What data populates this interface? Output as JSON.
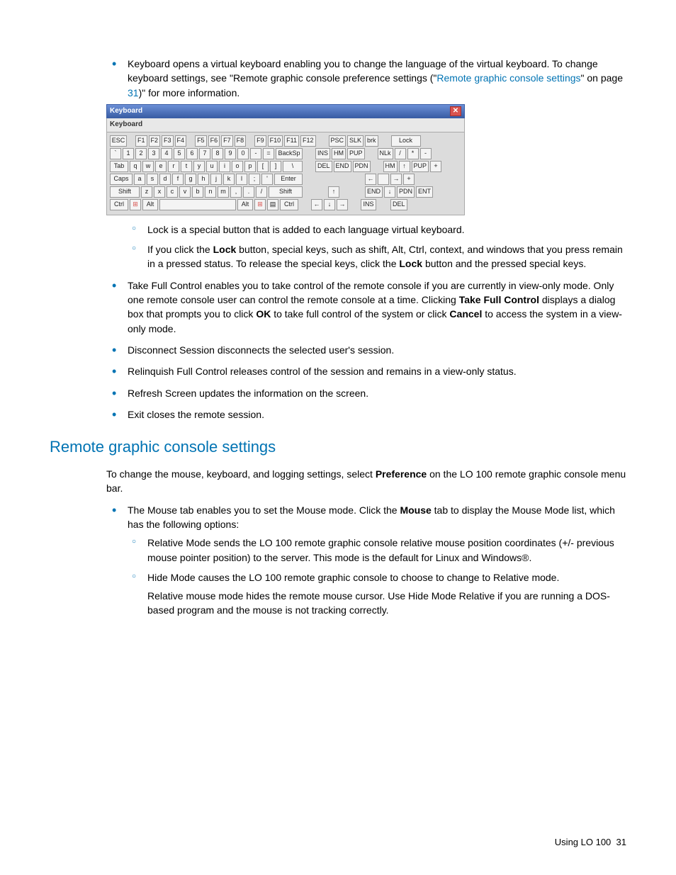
{
  "top_bullet": {
    "lead": "Keyboard opens a virtual keyboard enabling you to change the language of the virtual keyboard. To change keyboard settings, see \"Remote graphic console preference settings (\"",
    "link": "Remote graphic console settings",
    "mid": "\" on page ",
    "page": "31",
    "tail": ")\" for more information."
  },
  "keyboard": {
    "title": "Keyboard",
    "menu": "Keyboard",
    "lock": "Lock",
    "row1": [
      "ESC",
      "",
      "F1",
      "F2",
      "F3",
      "F4",
      "",
      "F5",
      "F6",
      "F7",
      "F8",
      "",
      "F9",
      "F10",
      "F11",
      "F12"
    ],
    "row1r": [
      "PSC",
      "SLK",
      "brk"
    ],
    "row2": [
      "`",
      "1",
      "2",
      "3",
      "4",
      "5",
      "6",
      "7",
      "8",
      "9",
      "0",
      "-",
      "=",
      "BackSp"
    ],
    "row2r": [
      "INS",
      "HM",
      "PUP"
    ],
    "row2n": [
      "NLk",
      "/",
      "*",
      "-"
    ],
    "row3": [
      "Tab",
      "q",
      "w",
      "e",
      "r",
      "t",
      "y",
      "u",
      "i",
      "o",
      "p",
      "[",
      "]",
      "\\"
    ],
    "row3r": [
      "DEL",
      "END",
      "PDN"
    ],
    "row3n": [
      "HM",
      "↑",
      "PUP"
    ],
    "row4": [
      "Caps",
      "a",
      "s",
      "d",
      "f",
      "g",
      "h",
      "j",
      "k",
      "l",
      ";",
      "'",
      "Enter"
    ],
    "row4n": [
      "←",
      "",
      "→"
    ],
    "row5": [
      "Shift",
      "z",
      "x",
      "c",
      "v",
      "b",
      "n",
      "m",
      ",",
      ".",
      "/",
      "Shift"
    ],
    "row5c": [
      "",
      "↑",
      ""
    ],
    "row5n": [
      "END",
      "↓",
      "PDN"
    ],
    "row6": [
      "Ctrl",
      "⊞",
      "Alt",
      "",
      "Alt",
      "⊞",
      "▤",
      "Ctrl"
    ],
    "row6c": [
      "←",
      "↓",
      "→"
    ],
    "row6n": [
      "INS",
      "",
      "DEL"
    ],
    "plus": "+",
    "ent": "ENT"
  },
  "sub_items": {
    "s1": "Lock is a special button that is added to each language virtual keyboard.",
    "s2a": "If you click the ",
    "s2b": "Lock",
    "s2c": " button, special keys, such as shift, Alt, Ctrl, context, and windows that you press remain in a pressed status. To release the special keys, click the ",
    "s2d": "Lock",
    "s2e": " button and the pressed special keys."
  },
  "bullets": {
    "b2a": "Take Full Control enables you to take control of the remote console if you are currently in view-only mode. Only one remote console user can control the remote console at a time. Clicking ",
    "b2b": "Take Full Control",
    "b2c": " displays a dialog box that prompts you to click ",
    "b2d": "OK",
    "b2e": " to take full control of the system or click ",
    "b2f": "Cancel",
    "b2g": " to access the system in a view-only mode.",
    "b3": "Disconnect Session disconnects the selected user's session.",
    "b4": "Relinquish Full Control releases control of the session and remains in a view-only status.",
    "b5": "Refresh Screen updates the information on the screen.",
    "b6": "Exit closes the remote session."
  },
  "section": {
    "heading": "Remote graphic console settings",
    "p1a": "To change the mouse, keyboard, and logging settings, select ",
    "p1b": "Preference",
    "p1c": " on the LO 100 remote graphic console menu bar.",
    "mb1a": "The Mouse tab enables you to set the Mouse mode. Click the ",
    "mb1b": "Mouse",
    "mb1c": " tab to display the Mouse Mode list, which has the following options:",
    "ms1": "Relative Mode sends the LO 100 remote graphic console relative mouse position coordinates (+/- previous mouse pointer position) to the server. This mode is the default for Linux and Windows®.",
    "ms2a": "Hide Mode causes the LO 100 remote graphic console to choose to change to Relative mode.",
    "ms2b": "Relative mouse mode hides the remote mouse cursor. Use Hide Mode Relative if you are running a DOS-based program and the mouse is not tracking correctly."
  },
  "footer": {
    "text": "Using LO 100",
    "page": "31"
  }
}
